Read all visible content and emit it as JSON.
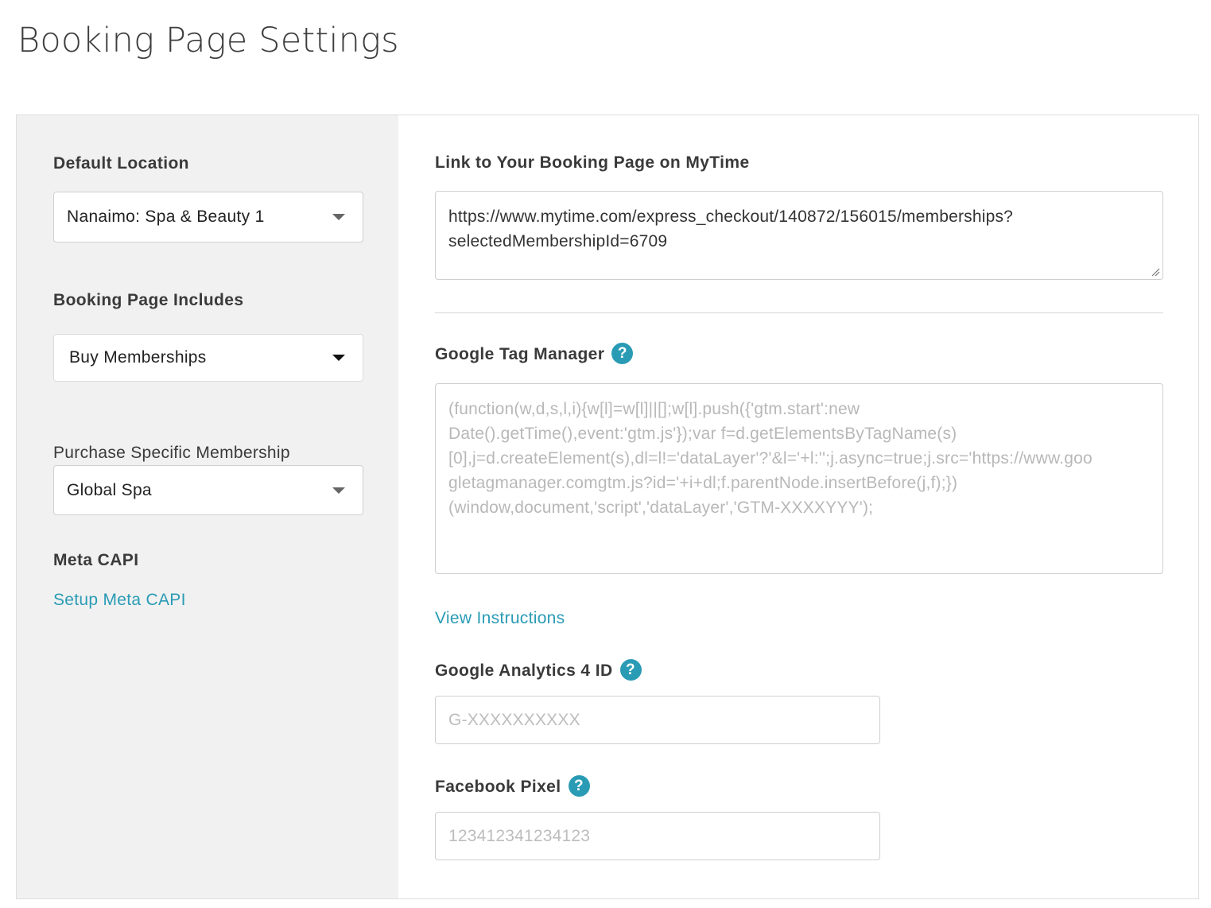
{
  "page": {
    "title": "Booking Page Settings"
  },
  "left": {
    "default_location": {
      "label": "Default Location",
      "value": "Nanaimo: Spa & Beauty 1"
    },
    "booking_includes": {
      "label": "Booking Page Includes",
      "value": "Buy Memberships"
    },
    "specific_membership": {
      "label": "Purchase Specific Membership",
      "value": "Global Spa"
    },
    "meta_capi": {
      "label": "Meta CAPI",
      "link": "Setup Meta CAPI"
    }
  },
  "right": {
    "booking_link": {
      "label": "Link to Your Booking Page on MyTime",
      "line1": "https://www.mytime.com/express_checkout/140872/156015/memberships?",
      "line2": "selectedMembershipId=6709"
    },
    "gtm": {
      "label": "Google Tag Manager",
      "help": "?",
      "placeholder": "(function(w,d,s,l,i){w[l]=w[l]||[];w[l].push({'gtm.start':new Date().getTime(),event:'gtm.js'});var f=d.getElementsByTagName(s)[0],j=d.createElement(s),dl=l!='dataLayer'?'&l='+l:'';j.async=true;j.src='https://www.googletagmanager.comgtm.js?id='+i+dl;f.parentNode.insertBefore(j,f);})(window,document,'script','dataLayer','GTM-XXXXYYY');",
      "line1": "(function(w,d,s,l,i){w[l]=w[l]||[];w[l].push({'gtm.start':new",
      "line2": "Date().getTime(),event:'gtm.js'});var f=d.getElementsByTagName(s)",
      "line3": "[0],j=d.createElement(s),dl=l!='dataLayer'?'&l='+l:'';j.async=true;j.src='https://www.goo",
      "line4": "gletagmanager.comgtm.js?id='+i+dl;f.parentNode.insertBefore(j,f);})",
      "line5": "(window,document,'script','dataLayer','GTM-XXXXYYY');",
      "instructions_link": "View Instructions"
    },
    "ga4": {
      "label": "Google Analytics 4 ID",
      "help": "?",
      "placeholder": "G-XXXXXXXXXX"
    },
    "facebook_pixel": {
      "label": "Facebook Pixel",
      "help": "?",
      "placeholder": "123412341234123"
    }
  },
  "colors": {
    "accent": "#2a9bb5",
    "left_panel_bg": "#f1f1f1",
    "border": "#cfcfcf"
  }
}
